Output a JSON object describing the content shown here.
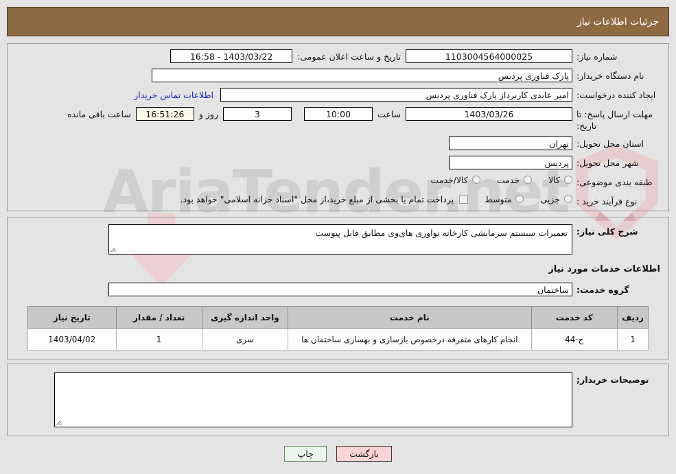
{
  "header": {
    "title": "جزئیات اطلاعات نیاز"
  },
  "form": {
    "need_number_label": "شماره نیاز:",
    "need_number_value": "1103004564000025",
    "public_announce_label": "تاریخ و ساعت اعلان عمومی:",
    "public_announce_value": "1403/03/22 - 16:58",
    "buyer_org_label": "نام دستگاه خریدار:",
    "buyer_org_value": "پارک فناوری پردیس",
    "creator_label": "ایجاد کننده درخواست:",
    "creator_value": "امیر عابدی کاربرداز پارک فناوری پردیس",
    "contact_link": "اطلاعات تماس خریدار",
    "deadline_label": "مهلت ارسال پاسخ: تا تاریخ:",
    "deadline_date": "1403/03/26",
    "hour_label": "ساعت",
    "deadline_time": "10:00",
    "days_remaining": "3",
    "days_label": "روز و",
    "clock_remaining": "16:51:26",
    "remaining_label": "ساعت باقی مانده",
    "province_label": "استان محل تحویل:",
    "province_value": "تهران",
    "city_label": "شهر محل تحویل:",
    "city_value": "پردیس",
    "category_label": "طبقه بندی موضوعی:",
    "category_options": [
      {
        "label": "کالا",
        "selected": false
      },
      {
        "label": "خدمت",
        "selected": false
      },
      {
        "label": "کالا/خدمت",
        "selected": false
      }
    ],
    "process_label": "نوع فرآیند خرید :",
    "process_options": [
      {
        "label": "جزیی",
        "selected": false
      },
      {
        "label": "متوسط",
        "selected": false
      }
    ],
    "treasury_checkbox_checked": false,
    "treasury_statement": "پرداخت تمام یا بخشی از مبلغ خرید،از محل \"اسناد خزانه اسلامی\" خواهد بود."
  },
  "description": {
    "label": "شرح کلی نیاز:",
    "value": "تعمیرات سیستم سرمایشی کارخانه نواوری های‌وی مطابق فایل پیوست"
  },
  "services": {
    "section_title": "اطلاعات خدمات مورد نیاز",
    "group_label": "گروه خدمت:",
    "group_value": "ساختمان",
    "columns": [
      "ردیف",
      "کد خدمت",
      "نام خدمت",
      "واحد اندازه گیری",
      "تعداد / مقدار",
      "تاریخ نیاز"
    ],
    "rows": [
      {
        "radif": "1",
        "code": "ج-44",
        "name": "انجام کارهای متفرقه درخصوص بازسازی و بهسازی ساختمان ها",
        "unit": "سری",
        "qty": "1",
        "date": "1403/04/02"
      }
    ]
  },
  "buyer_notes": {
    "label": "توضیحات خریدار;",
    "value": ""
  },
  "footer": {
    "back_label": "بازگشت",
    "print_label": "چاپ"
  },
  "watermark": {
    "text": "AriaTender.net"
  },
  "colors": {
    "header_bg": "#8d6a42",
    "page_bg": "#e4e4e4",
    "link": "#2020cc",
    "table_header_bg": "#c8c8c8",
    "back_btn_bg": "#fbd5d5",
    "print_btn_bg": "#e9f7e9",
    "countdown_bg": "#fbfbe7"
  }
}
